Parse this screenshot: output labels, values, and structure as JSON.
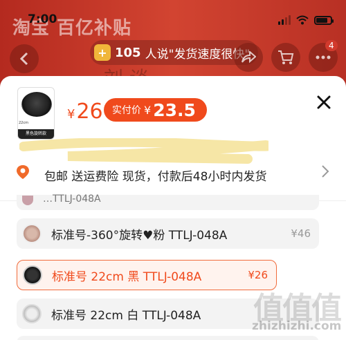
{
  "status_bar": {
    "time": "7:00"
  },
  "header": {
    "banner_text": "淘宝 百亿补贴",
    "rumor": {
      "count": "105",
      "text": "人说\"发货速度很快\""
    },
    "cart_badge": "4"
  },
  "sheet": {
    "product_thumb": {
      "size_label": "22cm",
      "caption": "黑色旋转款"
    },
    "price": {
      "currency": "¥",
      "value": "26"
    },
    "paid_price": {
      "label": "实付价",
      "currency": "¥",
      "value": "23.5"
    },
    "shipping": {
      "text": "包邮  送运费险  现货，付款后48小时内发货"
    },
    "options": [
      {
        "name": "…TTLJ-048A",
        "price": ""
      },
      {
        "name": "标准号-360°旋转♥粉 TTLJ-048A",
        "price": "¥46"
      },
      {
        "name": "标准号 22cm 黑 TTLJ-048A",
        "price": "¥26",
        "selected": true
      },
      {
        "name": "标准号 22cm 白 TTLJ-048A",
        "price": ""
      }
    ]
  },
  "watermark": {
    "glyphs": "值值值",
    "url": "zhizhizhi.com"
  },
  "colors": {
    "accent": "#f04a1c",
    "banner": "#c9362a",
    "selected_bg": "#fff3ee"
  }
}
